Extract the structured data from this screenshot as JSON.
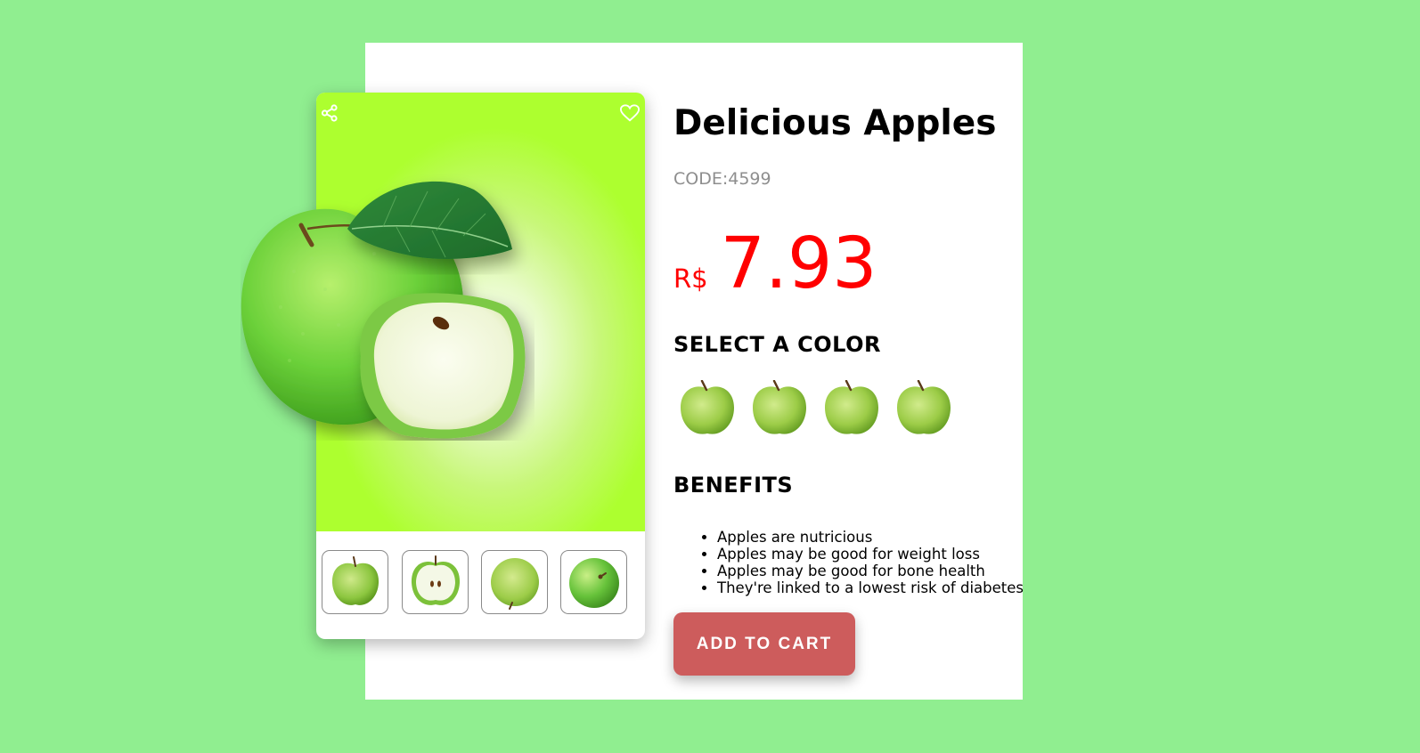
{
  "product": {
    "title": "Delicious Apples",
    "code": "CODE:4599",
    "currency": "R$",
    "price": "7.93"
  },
  "colors": {
    "heading": "SELECT A COLOR",
    "swatches": [
      "green-apple-swatch",
      "green-apple-swatch",
      "green-apple-swatch",
      "green-apple-swatch"
    ]
  },
  "benefits": {
    "heading": "BENEFITS",
    "items": [
      "Apples are nutricious",
      "Apples may be good for weight loss",
      "Apples may be good for bone health",
      "They're linked to a lowest risk of diabetes"
    ]
  },
  "cart": {
    "label": "ADD TO CART"
  },
  "card": {
    "icons": [
      "share-icon",
      "heart-icon"
    ],
    "thumbnails": [
      "whole-apple-thumbnail",
      "halved-apple-thumbnail",
      "apple-bottom-thumbnail",
      "apple-top-thumbnail"
    ]
  },
  "colors_palette": {
    "page_background": "#90ee90",
    "hero_background": "#adff2f",
    "price": "#ff0000",
    "button": "#cd5c5c"
  }
}
